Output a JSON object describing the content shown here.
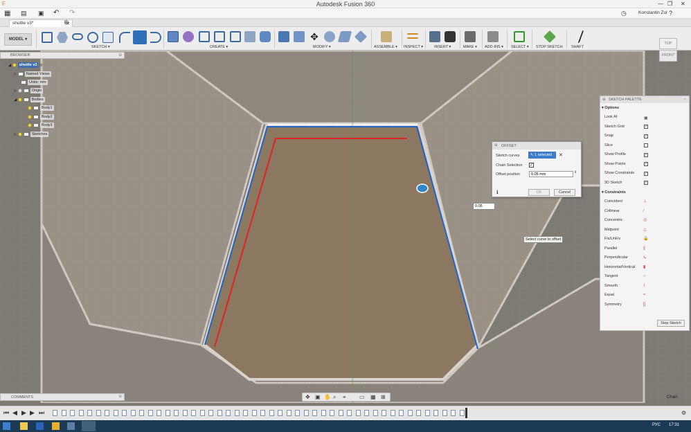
{
  "window": {
    "title": "Autodesk Fusion 360"
  },
  "appbar": {
    "user": "Konstantin Zol"
  },
  "tabs": [
    {
      "label": "shuttle v3*"
    }
  ],
  "toolbar": {
    "mode": "MODEL",
    "groups": [
      {
        "label": "SKETCH ▾"
      },
      {
        "label": "CREATE ▾"
      },
      {
        "label": "MODIFY ▾"
      },
      {
        "label": "ASSEMBLE ▾"
      },
      {
        "label": "INSPECT ▾"
      },
      {
        "label": "INSERT ▾"
      },
      {
        "label": "MAKE ▾"
      },
      {
        "label": "ADD-INS ▾"
      },
      {
        "label": "SELECT ▾"
      },
      {
        "label": "STOP SKETCH"
      },
      {
        "label": "SHAFT"
      }
    ]
  },
  "browser": {
    "title": "BROWSER",
    "items": [
      {
        "label": "shuttle v3"
      },
      {
        "label": "Named Views"
      },
      {
        "label": "Units: mm"
      },
      {
        "label": "Origin"
      },
      {
        "label": "Bodies"
      },
      {
        "label": "Body1"
      },
      {
        "label": "Body2"
      },
      {
        "label": "Body3"
      },
      {
        "label": "Sketches"
      }
    ]
  },
  "comments": {
    "label": "COMMENTS"
  },
  "viewcube": {
    "top": "TOP",
    "front": "FRONT"
  },
  "offset_dialog": {
    "title": "OFFSET",
    "sketch_curves_label": "Sketch curves",
    "selected_text": "1 selected",
    "chain_selection_label": "Chain Selection",
    "chain_selection_checked": true,
    "offset_position_label": "Offset position",
    "offset_position_value": "0.05 mm",
    "ok_label": "OK",
    "cancel_label": "Cancel"
  },
  "canvas": {
    "input_value": "0.05",
    "tooltip": "Select curve to offset"
  },
  "sketch_palette": {
    "title": "SKETCH PALETTE",
    "options_title": "Options",
    "options": [
      {
        "label": "Look At",
        "type": "icon"
      },
      {
        "label": "Sketch Grid",
        "checked": true
      },
      {
        "label": "Snap",
        "checked": true
      },
      {
        "label": "Slice",
        "checked": false
      },
      {
        "label": "Show Profile",
        "checked": true
      },
      {
        "label": "Show Points",
        "checked": true
      },
      {
        "label": "Show Constraints",
        "checked": true
      },
      {
        "label": "3D Sketch",
        "checked": true
      }
    ],
    "constraints_title": "Constraints",
    "constraints": [
      {
        "label": "Coincident",
        "glyph": "⊥"
      },
      {
        "label": "Collinear",
        "glyph": "⁄"
      },
      {
        "label": "Concentric",
        "glyph": "◎"
      },
      {
        "label": "Midpoint",
        "glyph": "△"
      },
      {
        "label": "Fix/UnFix",
        "glyph": "🔒"
      },
      {
        "label": "Parallel",
        "glyph": "∥"
      },
      {
        "label": "Perpendicular",
        "glyph": "⊾"
      },
      {
        "label": "Horizontal/Vertical",
        "glyph": "▮"
      },
      {
        "label": "Tangent",
        "glyph": "○"
      },
      {
        "label": "Smooth",
        "glyph": "⌇"
      },
      {
        "label": "Equal",
        "glyph": "="
      },
      {
        "label": "Symmetry",
        "glyph": "[]"
      }
    ],
    "stop_sketch_label": "Stop Sketch"
  },
  "status": {
    "chain": "Chain"
  },
  "taskbar": {
    "lang": "РУС",
    "time": "17:31"
  },
  "colors": {
    "offset_red": "#e0231c",
    "selected_blue": "#1d63c8",
    "sketch_fill": "#8c7860",
    "viewport_bg": "#7d7a74"
  }
}
